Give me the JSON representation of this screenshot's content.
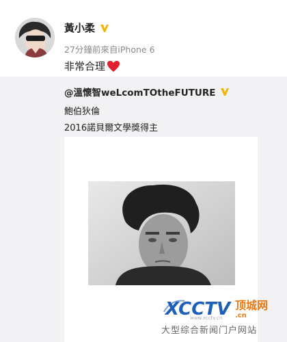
{
  "post": {
    "author": "黃小柔",
    "meta": "27分鐘前來自iPhone 6",
    "content": "非常合理",
    "icons": {
      "verified": "verified-badge-icon",
      "heart": "red-heart-icon"
    }
  },
  "repost": {
    "author": "@溫懷智weLcomTOtheFUTURE",
    "line1": "鮑伯狄倫",
    "line2": "2016諾貝爾文學獎得主"
  },
  "watermark": {
    "logo_text": "XCCTV",
    "logo_cn": "顶城网",
    "logo_domain": ".cn",
    "url": "www.xcctv.cn",
    "subtitle": "大型综合新闻门户网站"
  },
  "colors": {
    "verified": "#f2b400",
    "heart": "#e0202c",
    "watermark_blue": "#1f5fb8",
    "watermark_orange": "#f07a12"
  }
}
